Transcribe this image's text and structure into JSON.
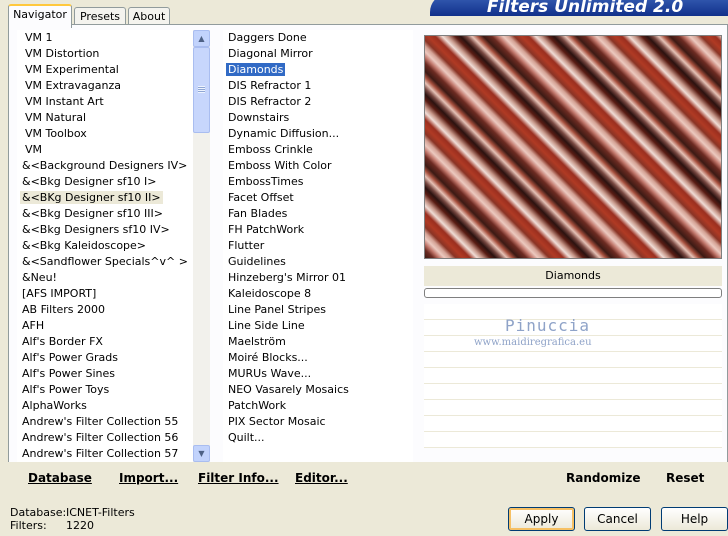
{
  "app": {
    "title": "Filters Unlimited 2.0"
  },
  "tabs": [
    "Navigator",
    "Presets",
    "About"
  ],
  "categories": [
    "VM 1",
    "VM Distortion",
    "VM Experimental",
    "VM Extravaganza",
    "VM Instant Art",
    "VM Natural",
    "VM Toolbox",
    "VM",
    "&<Background Designers IV>",
    "&<Bkg Designer sf10 I>",
    "&<BKg Designer sf10 II>",
    "&<Bkg Designer sf10 III>",
    "&<Bkg Designers sf10 IV>",
    "&<Bkg Kaleidoscope>",
    "&<Sandflower Specials^v^ >",
    "&Neu!",
    "[AFS IMPORT]",
    "AB Filters 2000",
    "AFH",
    "Alf's Border FX",
    "Alf's Power Grads",
    "Alf's Power Sines",
    "Alf's Power Toys",
    "AlphaWorks",
    "Andrew's Filter Collection 55",
    "Andrew's Filter Collection 56",
    "Andrew's Filter Collection 57"
  ],
  "selected_category": "&<BKg Designer sf10 II>",
  "filters": [
    {
      "label": "Daggers Done",
      "group": false
    },
    {
      "label": "Diagonal Mirror",
      "group": false
    },
    {
      "label": "Diamonds",
      "group": false
    },
    {
      "label": "DIS Refractor 1",
      "group": false
    },
    {
      "label": "DIS Refractor 2",
      "group": true
    },
    {
      "label": "Downstairs",
      "group": false
    },
    {
      "label": "Dynamic Diffusion...",
      "group": false
    },
    {
      "label": "Emboss Crinkle",
      "group": false
    },
    {
      "label": "Emboss With Color",
      "group": false
    },
    {
      "label": "EmbossTimes",
      "group": false
    },
    {
      "label": "Facet Offset",
      "group": false
    },
    {
      "label": "Fan Blades",
      "group": false
    },
    {
      "label": "FH PatchWork",
      "group": false
    },
    {
      "label": "Flutter",
      "group": true
    },
    {
      "label": "Guidelines",
      "group": true
    },
    {
      "label": "Hinzeberg's Mirror 01",
      "group": false
    },
    {
      "label": "Kaleidoscope 8",
      "group": false
    },
    {
      "label": "Line Panel Stripes",
      "group": false
    },
    {
      "label": "Line Side Line",
      "group": false
    },
    {
      "label": "Maelström",
      "group": false
    },
    {
      "label": "Moiré Blocks...",
      "group": false
    },
    {
      "label": "MURUs Wave...",
      "group": false
    },
    {
      "label": "NEO Vasarely Mosaics",
      "group": false
    },
    {
      "label": "PatchWork",
      "group": false
    },
    {
      "label": "PIX Sector Mosaic",
      "group": false
    },
    {
      "label": "Quilt...",
      "group": false
    }
  ],
  "selected_filter": "Diamonds",
  "preview": {
    "filter_name": "Diamonds",
    "progress": 0
  },
  "watermark": {
    "line1": "Pinuccia",
    "line2": "www.maidiregrafica.eu"
  },
  "toolbar": {
    "database": "Database",
    "import": "Import...",
    "filter_info": "Filter Info...",
    "editor": "Editor...",
    "randomize": "Randomize",
    "reset": "Reset"
  },
  "status": {
    "database_label": "Database:",
    "database_value": "ICNET-Filters",
    "filters_label": "Filters:",
    "filters_value": "1220"
  },
  "buttons": {
    "apply": "Apply",
    "cancel": "Cancel",
    "help": "Help"
  },
  "colors": {
    "selection": "#316ac5",
    "background": "#ece9d8"
  }
}
